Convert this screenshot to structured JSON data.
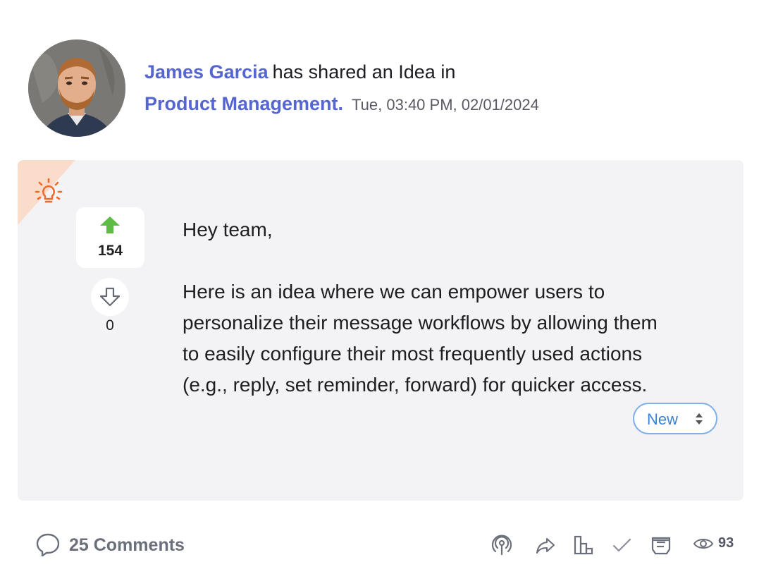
{
  "post": {
    "author": "James Garcia",
    "shared_text": "has shared an Idea in",
    "category": "Product Management.",
    "timestamp": "Tue, 03:40 PM, 02/01/2024",
    "greeting": "Hey team,",
    "body": "Here is an idea where we can empower users to personalize their message workflows by allowing them to easily configure their most frequently used actions (e.g., reply, set reminder, forward) for quicker access.",
    "type_icon": "lightbulb-icon"
  },
  "votes": {
    "upvotes": "154",
    "downvotes": "0",
    "upvote_color": "#5dbb46"
  },
  "status": {
    "selected": "New",
    "color": "#3b82d6"
  },
  "footer": {
    "comments_label": "25 Comments",
    "views_count": "93",
    "actions": [
      "podcast-icon",
      "share-icon",
      "chart-icon",
      "checkmark-icon",
      "notes-icon",
      "eye-icon"
    ]
  },
  "colors": {
    "link": "#5565d2",
    "card_bg": "#f3f3f6",
    "accent_orange": "#ef6a2b"
  }
}
